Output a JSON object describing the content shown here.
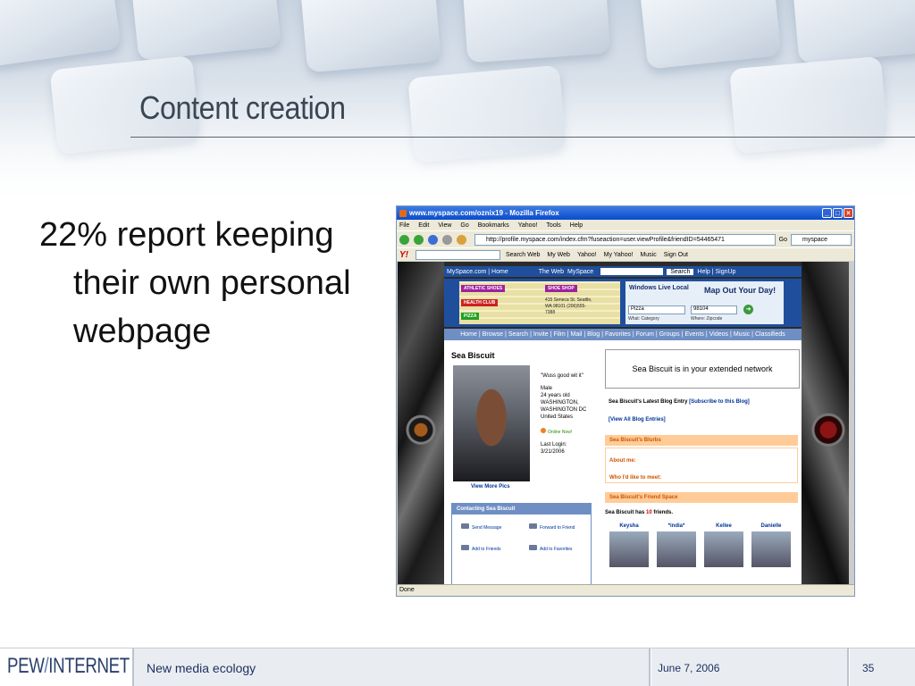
{
  "slide": {
    "title": "Content creation",
    "bullet": "22% report keeping their own personal webpage"
  },
  "footer": {
    "logo_left": "PEW",
    "logo_slash": "/",
    "logo_right": "INTERNET",
    "text": "New media ecology",
    "date": "June 7, 2006",
    "page_number": "35"
  },
  "browser": {
    "window_title": "www.myspace.com/oznix19 - Mozilla Firefox",
    "menu": [
      "File",
      "Edit",
      "View",
      "Go",
      "Bookmarks",
      "Yahoo!",
      "Tools",
      "Help"
    ],
    "url": "http://profile.myspace.com/index.cfm?fuseaction=user.viewProfile&friendID=54465471",
    "go_label": "Go",
    "google_search_value": "myspace",
    "yahoo_bar": [
      "Search Web",
      "My Web",
      "Yahoo!",
      "My Yahoo!",
      "Music",
      "Sign Out"
    ],
    "status": "Done"
  },
  "myspace": {
    "top": {
      "home": "MySpace.com | Home",
      "web": "The Web",
      "site": "MySpace",
      "search_button": "Search",
      "help": "Help | SignUp"
    },
    "ad": {
      "tags": [
        "ATHLETIC SHOES",
        "HEALTH CLUB",
        "PIZZA",
        "SHOE SHOP"
      ],
      "address": "415 Seneca St. Seattle, WA 98101 (206)555-7388",
      "logo": "Windows Live Local",
      "tagline": "Map Out Your Day!",
      "what_value": "Pizza",
      "where_value": "98104",
      "what_label": "What: Category",
      "where_label": "Where: Zipcode"
    },
    "nav": [
      "Home",
      "Browse",
      "Search",
      "Invite",
      "Film",
      "Mail",
      "Blog",
      "Favorites",
      "Forum",
      "Groups",
      "Events",
      "Videos",
      "Music",
      "Classifieds"
    ],
    "profile": {
      "name": "Sea Biscuit",
      "quote": "\"Wuss good wit it\"",
      "gender": "Male",
      "age": "24 years old",
      "location": "WASHINGTON, WASHINGTON DC",
      "country": "United States",
      "online": "Online Now!",
      "last_login_label": "Last Login:",
      "last_login": "3/21/2006",
      "view_more": "View More Pics"
    },
    "network": "Sea Biscuit is in your extended network",
    "blog": {
      "latest": "Sea Biscuit's Latest Blog Entry",
      "subscribe": "[Subscribe to this Blog]",
      "view_all": "[View All Blog Entries]"
    },
    "blurbs": {
      "header": "Sea Biscuit's Blurbs",
      "about": "About me:",
      "meet": "Who I'd like to meet:"
    },
    "friends": {
      "header": "Sea Biscuit's Friend Space",
      "count_prefix": "Sea Biscuit has",
      "count": "10",
      "count_suffix": "friends.",
      "names": [
        "Keysha",
        "*india*",
        "Kellee",
        "Danielle"
      ]
    },
    "contact": {
      "header": "Contacting Sea Biscuit",
      "links": [
        "Send Message",
        "Forward to Friend",
        "Add to Friends",
        "Add to Favorites"
      ]
    }
  }
}
